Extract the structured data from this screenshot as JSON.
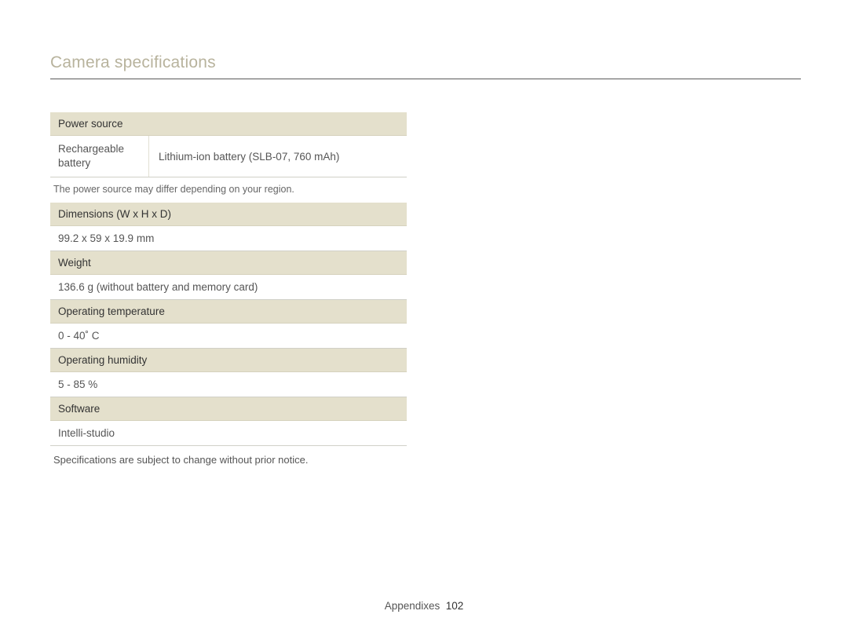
{
  "title": "Camera specifications",
  "sections": {
    "power": {
      "header": "Power source",
      "row_label": "Rechargeable battery",
      "row_value": "Lithium-ion battery (SLB-07, 760 mAh)",
      "note": "The power source may differ depending on your region."
    },
    "dimensions": {
      "header": "Dimensions (W x H x D)",
      "value": "99.2 x 59 x 19.9 mm"
    },
    "weight": {
      "header": "Weight",
      "value": "136.6 g (without battery and memory card)"
    },
    "temp": {
      "header": "Operating temperature",
      "value": "0 - 40˚ C"
    },
    "humidity": {
      "header": "Operating humidity",
      "value": "5 - 85 %"
    },
    "software": {
      "header": "Software",
      "value": "Intelli-studio"
    }
  },
  "footnote": "Specifications are subject to change without prior notice.",
  "footer": {
    "section": "Appendixes",
    "page": "102"
  }
}
